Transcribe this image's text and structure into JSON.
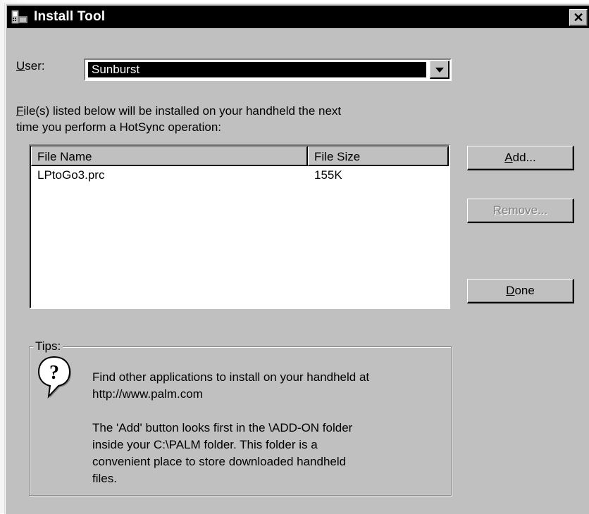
{
  "window": {
    "title": "Install Tool",
    "close_glyph": "✕"
  },
  "user": {
    "label": "User:",
    "label_access_key": "U",
    "label_rest": "ser:",
    "selected": "Sunburst"
  },
  "instructions": {
    "line1_key": "F",
    "line1_rest": "ile(s) listed below will be installed on your handheld the next",
    "line2": "time you perform a HotSync operation:"
  },
  "file_list": {
    "columns": [
      "File Name",
      "File Size"
    ],
    "rows": [
      {
        "name": "LPtoGo3.prc",
        "size": "155K"
      }
    ]
  },
  "buttons": {
    "add": {
      "key": "A",
      "rest": "dd..."
    },
    "remove": {
      "key": "R",
      "rest": "emove..."
    },
    "done": {
      "key": "D",
      "rest": "one"
    }
  },
  "tips": {
    "label": "Tips:",
    "icon": "question-balloon-icon",
    "para1": [
      "Find other applications to install on your handheld at",
      "http://www.palm.com"
    ],
    "para2": [
      "The 'Add' button looks first in the \\ADD-ON folder",
      "inside your C:\\PALM folder. This folder is a",
      "convenient place to store downloaded handheld",
      "files."
    ]
  },
  "colors": {
    "face": "#c0c0c0",
    "titlebar": "#000000",
    "selection": "#000000",
    "disabled_text": "#808080"
  }
}
